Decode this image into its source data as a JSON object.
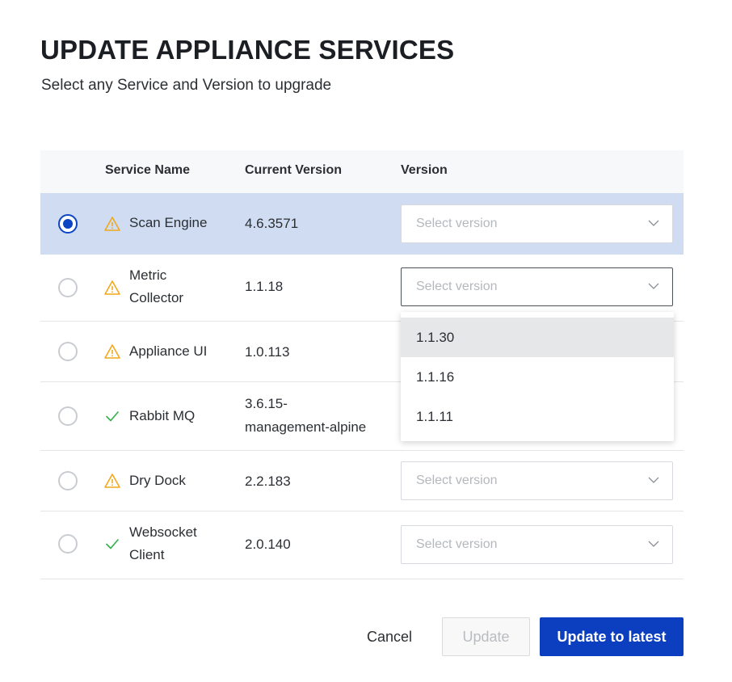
{
  "dialog": {
    "title": "UPDATE APPLIANCE SERVICES",
    "subtitle": "Select any Service and Version to upgrade"
  },
  "table": {
    "headers": {
      "service_name": "Service Name",
      "current_version": "Current Version",
      "version": "Version"
    },
    "rows": [
      {
        "name_line1": "Scan Engine",
        "name_line2": "",
        "current_line1": "4.6.3571",
        "current_line2": "",
        "status": "warning-icon",
        "selected": true,
        "version_placeholder": "Select version"
      },
      {
        "name_line1": "Metric",
        "name_line2": "Collector",
        "current_line1": "1.1.18",
        "current_line2": "",
        "status": "warning-icon",
        "selected": false,
        "version_placeholder": "Select version"
      },
      {
        "name_line1": "Appliance UI",
        "name_line2": "",
        "current_line1": "1.0.113",
        "current_line2": "",
        "status": "warning-icon",
        "selected": false,
        "version_placeholder": ""
      },
      {
        "name_line1": "Rabbit MQ",
        "name_line2": "",
        "current_line1": "3.6.15-",
        "current_line2": "management-alpine",
        "status": "check-icon",
        "selected": false,
        "version_placeholder": ""
      },
      {
        "name_line1": "Dry Dock",
        "name_line2": "",
        "current_line1": "2.2.183",
        "current_line2": "",
        "status": "warning-icon",
        "selected": false,
        "version_placeholder": "Select version"
      },
      {
        "name_line1": "Websocket",
        "name_line2": "Client",
        "current_line1": "2.0.140",
        "current_line2": "",
        "status": "check-icon",
        "selected": false,
        "version_placeholder": "Select version"
      }
    ]
  },
  "dropdown": {
    "options": [
      "1.1.30",
      "1.1.16",
      "1.1.11"
    ]
  },
  "footer": {
    "cancel_label": "Cancel",
    "update_label": "Update",
    "update_latest_label": "Update to latest"
  },
  "colors": {
    "primary": "#0b3fbf",
    "selected_row": "#cfdcf2",
    "warning": "#f0a81c",
    "success": "#37b24d"
  }
}
